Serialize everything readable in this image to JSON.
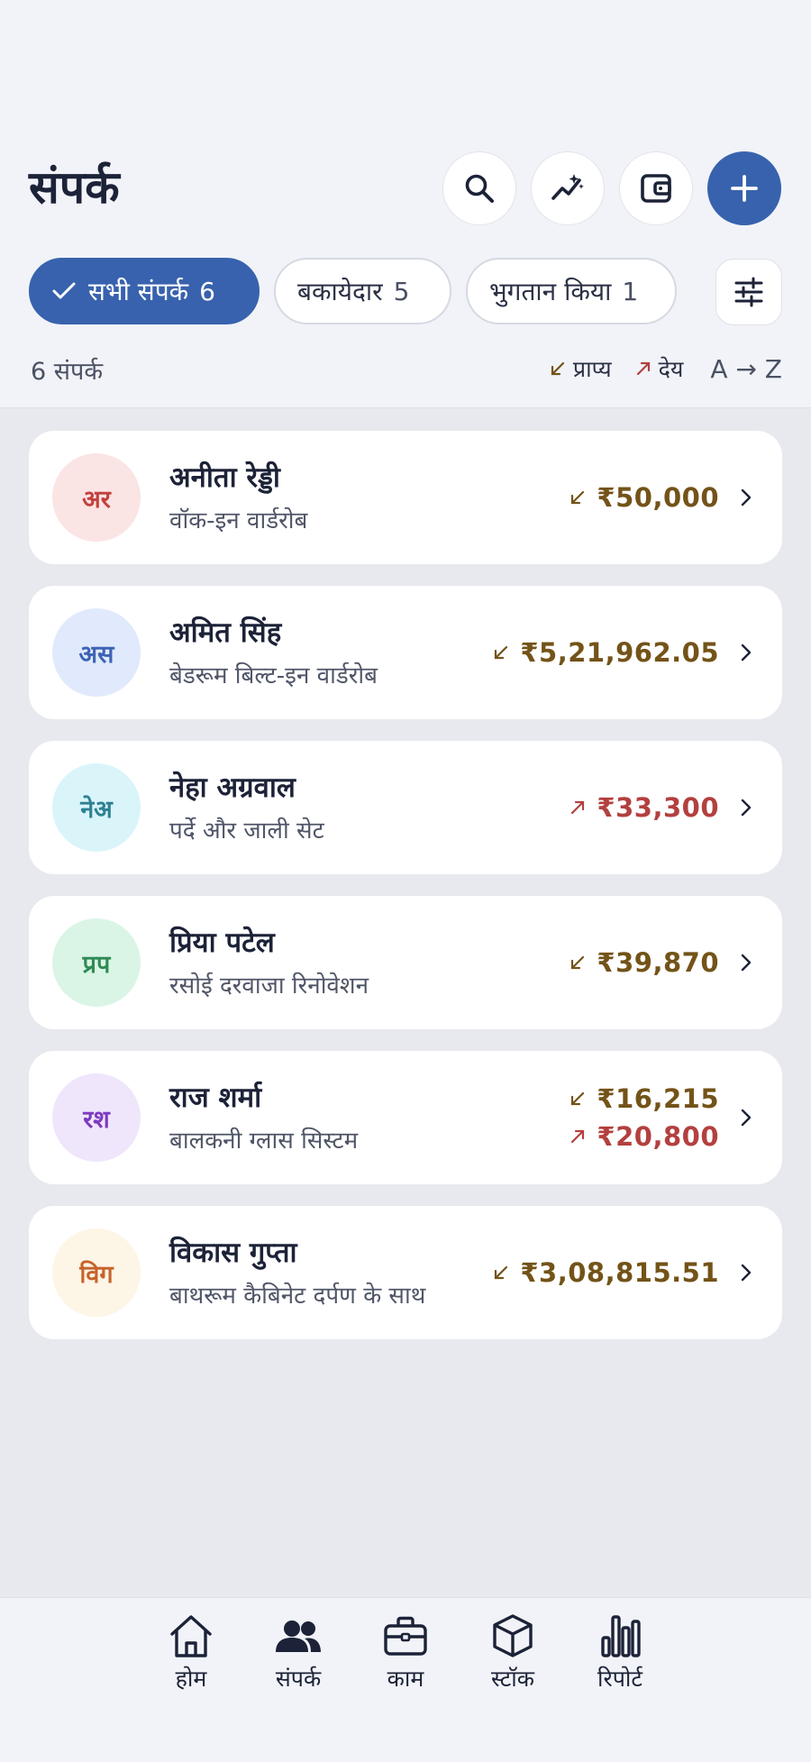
{
  "header": {
    "title": "संपर्क"
  },
  "actions": {
    "search_icon": "search-icon",
    "insights_icon": "sparkle-chart-icon",
    "wallet_icon": "wallet-icon",
    "add_icon": "plus-icon"
  },
  "chips": [
    {
      "label": "सभी संपर्क",
      "count": "6",
      "active": true
    },
    {
      "label": "बकायेदार",
      "count": "5",
      "active": false
    },
    {
      "label": "भुगतान किया",
      "count": "1",
      "active": false
    }
  ],
  "summary": {
    "count_text": "6 संपर्क",
    "receivable_label": "प्राप्य",
    "payable_label": "देय",
    "sort_label": "A → Z"
  },
  "contacts": [
    {
      "initials": "अर",
      "name": "अनीता रेड्डी",
      "project": "वॉक-इन वार्डरोब",
      "receivable": "₹50,000",
      "payable": null,
      "avatar_bg": "#fbe4e4",
      "avatar_fg": "#c2413d"
    },
    {
      "initials": "अस",
      "name": "अमित सिंह",
      "project": "बेडरूम बिल्ट-इन वार्डरोब",
      "receivable": "₹5,21,962.05",
      "payable": null,
      "avatar_bg": "#e1eafc",
      "avatar_fg": "#3d63b5"
    },
    {
      "initials": "नेअ",
      "name": "नेहा अग्रवाल",
      "project": "पर्दे और जाली सेट",
      "receivable": null,
      "payable": "₹33,300",
      "avatar_bg": "#d9f5fa",
      "avatar_fg": "#2e8193"
    },
    {
      "initials": "प्रप",
      "name": "प्रिया पटेल",
      "project": "रसोई दरवाजा रिनोवेशन",
      "receivable": "₹39,870",
      "payable": null,
      "avatar_bg": "#daf5e5",
      "avatar_fg": "#2f8a55"
    },
    {
      "initials": "रश",
      "name": "राज शर्मा",
      "project": "बालकनी ग्लास सिस्टम",
      "receivable": "₹16,215",
      "payable": "₹20,800",
      "avatar_bg": "#efe6fc",
      "avatar_fg": "#7d3bbd"
    },
    {
      "initials": "विग",
      "name": "विकास गुप्ता",
      "project": "बाथरूम कैबिनेट दर्पण के साथ",
      "receivable": "₹3,08,815.51",
      "payable": null,
      "avatar_bg": "#fdf5e6",
      "avatar_fg": "#c6632b"
    }
  ],
  "colors": {
    "accent": "#3862ad",
    "receivable": "#735318",
    "payable": "#b3403f"
  },
  "nav": [
    {
      "label": "होम",
      "icon": "home-icon"
    },
    {
      "label": "संपर्क",
      "icon": "contacts-icon",
      "active": true
    },
    {
      "label": "काम",
      "icon": "briefcase-icon"
    },
    {
      "label": "स्टॉक",
      "icon": "box-icon"
    },
    {
      "label": "रिपोर्ट",
      "icon": "bar-chart-icon"
    }
  ]
}
